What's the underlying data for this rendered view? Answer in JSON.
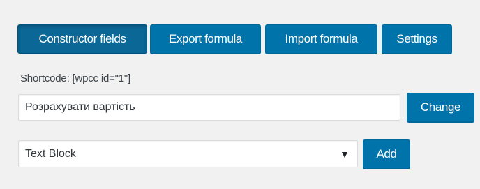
{
  "tabs": [
    {
      "label": "Constructor fields",
      "active": true
    },
    {
      "label": "Export formula",
      "active": false
    },
    {
      "label": "Import formula",
      "active": false
    },
    {
      "label": "Settings",
      "active": false
    }
  ],
  "shortcode": {
    "text": "Shortcode: [wpcc id=\"1\"]"
  },
  "calc_button": {
    "value": "Розрахувати вартість",
    "change_label": "Change"
  },
  "field_type": {
    "selected": "Text Block",
    "add_label": "Add"
  },
  "colors": {
    "button": "#0073aa",
    "background": "#f1f1f1"
  }
}
